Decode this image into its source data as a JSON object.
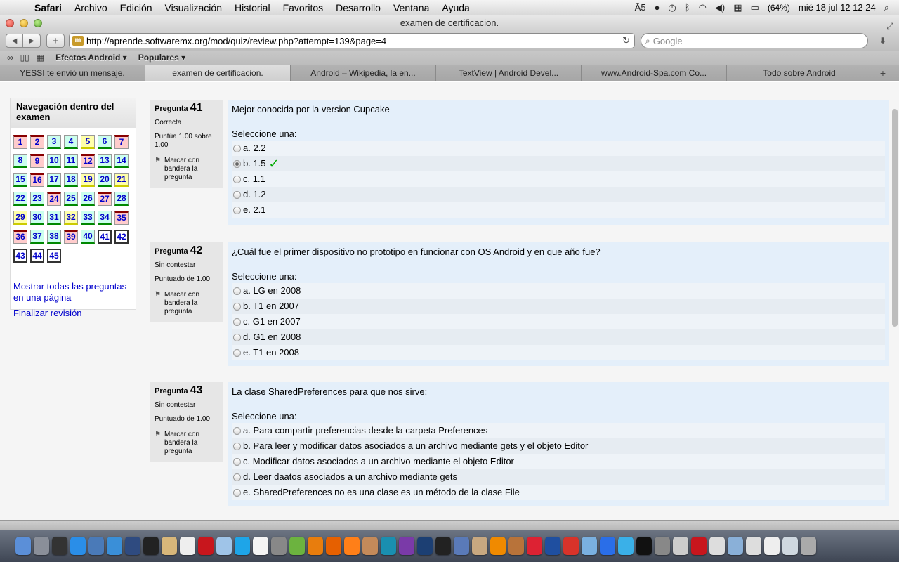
{
  "menubar": {
    "app": "Safari",
    "items": [
      "Archivo",
      "Edición",
      "Visualización",
      "Historial",
      "Favoritos",
      "Desarrollo",
      "Ventana",
      "Ayuda"
    ],
    "status": {
      "adobe_count": "5",
      "battery": "(64%)",
      "clock": "mié 18 jul  12 12 24"
    }
  },
  "window": {
    "title": "examen de certificacion."
  },
  "toolbar": {
    "url": "http://aprende.softwaremx.org/mod/quiz/review.php?attempt=139&page=4",
    "search_placeholder": "Google"
  },
  "bookmarks": [
    "Efectos Android ▾",
    "Populares ▾"
  ],
  "tabs": [
    {
      "label": "YESSI te envió un mensaje.",
      "active": false
    },
    {
      "label": "examen de certificacion.",
      "active": true
    },
    {
      "label": "Android – Wikipedia, la en...",
      "active": false
    },
    {
      "label": "TextView | Android Devel...",
      "active": false
    },
    {
      "label": "www.Android-Spa.com Co...",
      "active": false
    },
    {
      "label": "Todo sobre Android",
      "active": false
    }
  ],
  "nav": {
    "title": "Navegación dentro del examen",
    "questions": [
      {
        "n": "1",
        "s": "incorrect"
      },
      {
        "n": "2",
        "s": "incorrect"
      },
      {
        "n": "3",
        "s": "correct"
      },
      {
        "n": "4",
        "s": "correct"
      },
      {
        "n": "5",
        "s": "partial"
      },
      {
        "n": "6",
        "s": "correct"
      },
      {
        "n": "7",
        "s": "incorrect"
      },
      {
        "n": "8",
        "s": "correct"
      },
      {
        "n": "9",
        "s": "incorrect"
      },
      {
        "n": "10",
        "s": "correct"
      },
      {
        "n": "11",
        "s": "correct"
      },
      {
        "n": "12",
        "s": "incorrect"
      },
      {
        "n": "13",
        "s": "correct"
      },
      {
        "n": "14",
        "s": "correct"
      },
      {
        "n": "15",
        "s": "correct"
      },
      {
        "n": "16",
        "s": "incorrect"
      },
      {
        "n": "17",
        "s": "correct"
      },
      {
        "n": "18",
        "s": "correct"
      },
      {
        "n": "19",
        "s": "partial"
      },
      {
        "n": "20",
        "s": "correct"
      },
      {
        "n": "21",
        "s": "partial"
      },
      {
        "n": "22",
        "s": "correct"
      },
      {
        "n": "23",
        "s": "correct"
      },
      {
        "n": "24",
        "s": "incorrect"
      },
      {
        "n": "25",
        "s": "correct"
      },
      {
        "n": "26",
        "s": "correct"
      },
      {
        "n": "27",
        "s": "incorrect"
      },
      {
        "n": "28",
        "s": "correct"
      },
      {
        "n": "29",
        "s": "partial"
      },
      {
        "n": "30",
        "s": "correct"
      },
      {
        "n": "31",
        "s": "correct"
      },
      {
        "n": "32",
        "s": "partial"
      },
      {
        "n": "33",
        "s": "correct"
      },
      {
        "n": "34",
        "s": "correct"
      },
      {
        "n": "35",
        "s": "incorrect"
      },
      {
        "n": "36",
        "s": "incorrect"
      },
      {
        "n": "37",
        "s": "correct"
      },
      {
        "n": "38",
        "s": "correct"
      },
      {
        "n": "39",
        "s": "incorrect"
      },
      {
        "n": "40",
        "s": "correct"
      },
      {
        "n": "41",
        "s": "current"
      },
      {
        "n": "42",
        "s": "current"
      },
      {
        "n": "43",
        "s": "current"
      },
      {
        "n": "44",
        "s": "current"
      },
      {
        "n": "45",
        "s": "current"
      }
    ],
    "show_all": "Mostrar todas las preguntas en una página",
    "finish": "Finalizar revisión"
  },
  "questions": [
    {
      "label": "Pregunta",
      "number": "41",
      "state": "Correcta",
      "grade": "Puntúa 1.00 sobre 1.00",
      "flag": "Marcar con bandera la pregunta",
      "text": "Mejor conocida por la version Cupcake",
      "prompt": "Seleccione una:",
      "answers": [
        "a. 2.2",
        "b. 1.5",
        "c. 1.1",
        "d. 1.2",
        "e. 2.1"
      ],
      "selected": 1
    },
    {
      "label": "Pregunta",
      "number": "42",
      "state": "Sin contestar",
      "grade": "Puntuado de 1.00",
      "flag": "Marcar con bandera la pregunta",
      "text": "¿Cuál fue el primer dispositivo no prototipo en funcionar con OS Android y en que año fue?",
      "prompt": "Seleccione una:",
      "answers": [
        "a. LG en 2008",
        "b. T1 en 2007",
        "c. G1 en 2007",
        "d. G1 en 2008",
        "e. T1 en 2008"
      ],
      "selected": -1
    },
    {
      "label": "Pregunta",
      "number": "43",
      "state": "Sin contestar",
      "grade": "Puntuado de 1.00",
      "flag": "Marcar con bandera la pregunta",
      "text": "La clase SharedPreferences para que nos sirve:",
      "prompt": "Seleccione una:",
      "answers": [
        "a. Para compartir preferencias desde la carpeta Preferences",
        "b. Para leer y modificar datos asociados a un archivo mediante gets y el objeto Editor",
        "c. Modificar datos asociados a un archivo mediante el objeto Editor",
        "d. Leer daatos asociados a un archivo mediante gets",
        "e. SharedPreferences no es una clase es un método de la clase File"
      ],
      "selected": -1
    }
  ],
  "dock": [
    {
      "name": "finder-icon",
      "color": "#5b8fd8"
    },
    {
      "name": "launchpad-icon",
      "color": "#8a8f99"
    },
    {
      "name": "dashboard-icon",
      "color": "#333"
    },
    {
      "name": "app-store-icon",
      "color": "#2a8ee8"
    },
    {
      "name": "preview-icon",
      "color": "#4a7ab8"
    },
    {
      "name": "safari-icon",
      "color": "#3a8fd8"
    },
    {
      "name": "xcode-icon",
      "color": "#2f4b80"
    },
    {
      "name": "x11-icon",
      "color": "#222"
    },
    {
      "name": "notes-icon",
      "color": "#d8b77a"
    },
    {
      "name": "ical-icon",
      "color": "#eee"
    },
    {
      "name": "filezilla-icon",
      "color": "#c8161d"
    },
    {
      "name": "3d-box-icon",
      "color": "#9fc4e8"
    },
    {
      "name": "skype-icon",
      "color": "#1ea5e8"
    },
    {
      "name": "textedit-icon",
      "color": "#f4f4f4"
    },
    {
      "name": "camera-icon",
      "color": "#888"
    },
    {
      "name": "android-icon",
      "color": "#6cb33f"
    },
    {
      "name": "blender-icon",
      "color": "#e87d0d"
    },
    {
      "name": "firefox-icon",
      "color": "#e66000"
    },
    {
      "name": "illustrator-icon",
      "color": "#ff7f18"
    },
    {
      "name": "avatar-icon",
      "color": "#c48a5a"
    },
    {
      "name": "flower-icon",
      "color": "#1a8fb0"
    },
    {
      "name": "star-icon",
      "color": "#7a3aa8"
    },
    {
      "name": "photoshop-icon",
      "color": "#1c3f73"
    },
    {
      "name": "unity-icon",
      "color": "#222"
    },
    {
      "name": "cube-icon",
      "color": "#5a7ab8"
    },
    {
      "name": "mascot-icon",
      "color": "#c8a880"
    },
    {
      "name": "vlc-icon",
      "color": "#f08a00"
    },
    {
      "name": "game-icon",
      "color": "#b8733a"
    },
    {
      "name": "angry-birds-icon",
      "color": "#d23"
    },
    {
      "name": "globe-icon",
      "color": "#1f4fa0"
    },
    {
      "name": "puzzle-icon",
      "color": "#d8332a"
    },
    {
      "name": "preview2-icon",
      "color": "#7ab0e0"
    },
    {
      "name": "itunes-icon",
      "color": "#2a6ee8"
    },
    {
      "name": "twitter-icon",
      "color": "#3ab0e8"
    },
    {
      "name": "terminal-icon",
      "color": "#111"
    },
    {
      "name": "network-icon",
      "color": "#888"
    },
    {
      "name": "pen-icon",
      "color": "#ccc"
    },
    {
      "name": "flash-icon",
      "color": "#c8161d"
    },
    {
      "name": "document-icon",
      "color": "#ddd"
    },
    {
      "name": "folder-icon",
      "color": "#8ab0d8"
    },
    {
      "name": "mail-icon",
      "color": "#ddd"
    },
    {
      "name": "file-icon",
      "color": "#eee"
    },
    {
      "name": "stack-icon",
      "color": "#cfd8e0"
    },
    {
      "name": "trash-icon",
      "color": "#aaa"
    }
  ]
}
